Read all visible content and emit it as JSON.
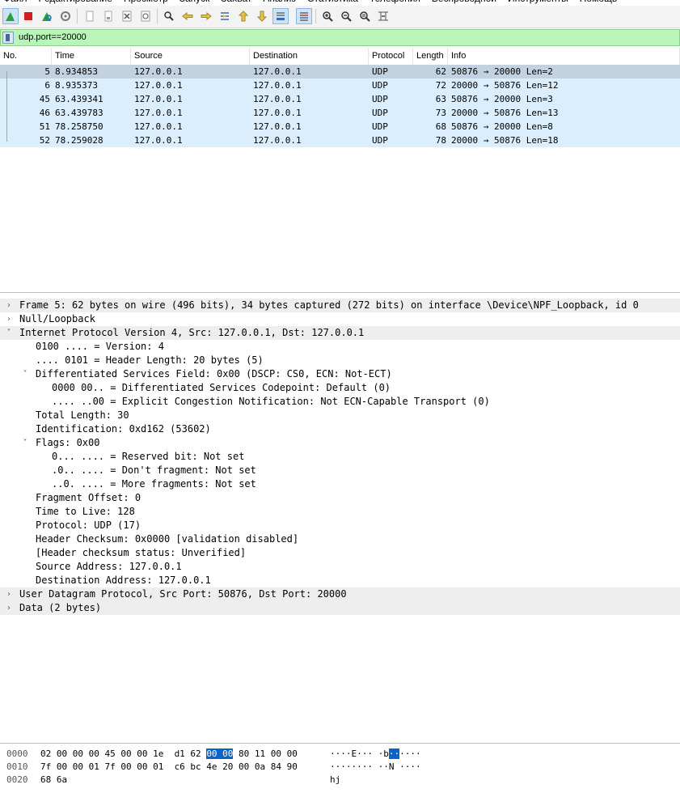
{
  "menu": [
    "Файл",
    "Редактирование",
    "Просмотр",
    "Запуск",
    "Захват",
    "Анализ",
    "Статистика",
    "Телефония",
    "Беспроводной",
    "Инструменты",
    "Помощь"
  ],
  "filter": {
    "value": "udp.port==20000"
  },
  "packet_list": {
    "columns": [
      "No.",
      "Time",
      "Source",
      "Destination",
      "Protocol",
      "Length",
      "Info"
    ],
    "rows": [
      {
        "no": "5",
        "time": "8.934853",
        "src": "127.0.0.1",
        "dst": "127.0.0.1",
        "proto": "UDP",
        "len": "62",
        "info": "50876 → 20000 Len=2"
      },
      {
        "no": "6",
        "time": "8.935373",
        "src": "127.0.0.1",
        "dst": "127.0.0.1",
        "proto": "UDP",
        "len": "72",
        "info": "20000 → 50876 Len=12"
      },
      {
        "no": "45",
        "time": "63.439341",
        "src": "127.0.0.1",
        "dst": "127.0.0.1",
        "proto": "UDP",
        "len": "63",
        "info": "50876 → 20000 Len=3"
      },
      {
        "no": "46",
        "time": "63.439783",
        "src": "127.0.0.1",
        "dst": "127.0.0.1",
        "proto": "UDP",
        "len": "73",
        "info": "20000 → 50876 Len=13"
      },
      {
        "no": "51",
        "time": "78.258750",
        "src": "127.0.0.1",
        "dst": "127.0.0.1",
        "proto": "UDP",
        "len": "68",
        "info": "50876 → 20000 Len=8"
      },
      {
        "no": "52",
        "time": "78.259028",
        "src": "127.0.0.1",
        "dst": "127.0.0.1",
        "proto": "UDP",
        "len": "78",
        "info": "20000 → 50876 Len=18"
      }
    ]
  },
  "details": [
    {
      "text": "Frame 5: 62 bytes on wire (496 bits), 34 bytes captured (272 bits) on interface \\Device\\NPF_Loopback, id 0",
      "arrow": "›",
      "level": 0,
      "shaded": true
    },
    {
      "text": "Null/Loopback",
      "arrow": "›",
      "level": 0,
      "shaded": false
    },
    {
      "text": "Internet Protocol Version 4, Src: 127.0.0.1, Dst: 127.0.0.1",
      "arrow": "˅",
      "level": 0,
      "shaded": true
    },
    {
      "text": "0100 .... = Version: 4",
      "arrow": "",
      "level": 1,
      "shaded": false
    },
    {
      "text": ".... 0101 = Header Length: 20 bytes (5)",
      "arrow": "",
      "level": 1,
      "shaded": false
    },
    {
      "text": "Differentiated Services Field: 0x00 (DSCP: CS0, ECN: Not-ECT)",
      "arrow": "˅",
      "level": 1,
      "shaded": false
    },
    {
      "text": "0000 00.. = Differentiated Services Codepoint: Default (0)",
      "arrow": "",
      "level": 2,
      "shaded": false
    },
    {
      "text": ".... ..00 = Explicit Congestion Notification: Not ECN-Capable Transport (0)",
      "arrow": "",
      "level": 2,
      "shaded": false
    },
    {
      "text": "Total Length: 30",
      "arrow": "",
      "level": 1,
      "shaded": false
    },
    {
      "text": "Identification: 0xd162 (53602)",
      "arrow": "",
      "level": 1,
      "shaded": false
    },
    {
      "text": "Flags: 0x00",
      "arrow": "˅",
      "level": 1,
      "shaded": false
    },
    {
      "text": "0... .... = Reserved bit: Not set",
      "arrow": "",
      "level": 2,
      "shaded": false
    },
    {
      "text": ".0.. .... = Don't fragment: Not set",
      "arrow": "",
      "level": 2,
      "shaded": false
    },
    {
      "text": "..0. .... = More fragments: Not set",
      "arrow": "",
      "level": 2,
      "shaded": false
    },
    {
      "text": "Fragment Offset: 0",
      "arrow": "",
      "level": 1,
      "shaded": false
    },
    {
      "text": "Time to Live: 128",
      "arrow": "",
      "level": 1,
      "shaded": false
    },
    {
      "text": "Protocol: UDP (17)",
      "arrow": "",
      "level": 1,
      "shaded": false
    },
    {
      "text": "Header Checksum: 0x0000 [validation disabled]",
      "arrow": "",
      "level": 1,
      "shaded": false
    },
    {
      "text": "[Header checksum status: Unverified]",
      "arrow": "",
      "level": 1,
      "shaded": false
    },
    {
      "text": "Source Address: 127.0.0.1",
      "arrow": "",
      "level": 1,
      "shaded": false
    },
    {
      "text": "Destination Address: 127.0.0.1",
      "arrow": "",
      "level": 1,
      "shaded": false
    },
    {
      "text": "User Datagram Protocol, Src Port: 50876, Dst Port: 20000",
      "arrow": "›",
      "level": 0,
      "shaded": true
    },
    {
      "text": "Data (2 bytes)",
      "arrow": "›",
      "level": 0,
      "shaded": true
    }
  ],
  "bytes": [
    {
      "offset": "0000",
      "hex_pre": "02 00 00 00 45 00 00 1e  d1 62 ",
      "hex_hl": "00 00",
      "hex_post": " 80 11 00 00",
      "ascii_pre": "····E··· ·b",
      "ascii_hl": "··",
      "ascii_post": "····"
    },
    {
      "offset": "0010",
      "hex_pre": "7f 00 00 01 7f 00 00 01  c6 bc 4e 20 00 0a 84 90",
      "hex_hl": "",
      "hex_post": "",
      "ascii_pre": "········ ··N ····",
      "ascii_hl": "",
      "ascii_post": ""
    },
    {
      "offset": "0020",
      "hex_pre": "68 6a",
      "hex_hl": "",
      "hex_post": "",
      "ascii_pre": "hj",
      "ascii_hl": "",
      "ascii_post": ""
    }
  ],
  "toolbar_icons": [
    "shark-fin-start-icon",
    "stop-capture-icon",
    "restart-capture-icon",
    "capture-options-icon",
    "open-file-icon",
    "save-file-icon",
    "close-file-icon",
    "reload-file-icon",
    "find-packet-icon",
    "go-back-icon",
    "go-forward-icon",
    "go-to-packet-icon",
    "go-first-icon",
    "go-last-icon",
    "autoscroll-icon",
    "colorize-icon",
    "zoom-in-icon",
    "zoom-out-icon",
    "zoom-normal-icon",
    "resize-columns-icon"
  ]
}
